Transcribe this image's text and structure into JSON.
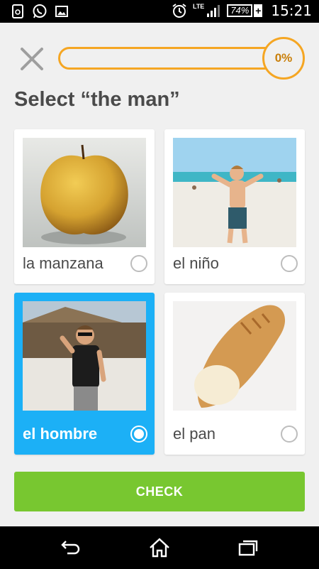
{
  "status_bar": {
    "network": "LTE",
    "battery": "74%",
    "time": "15:21"
  },
  "progress": {
    "value": 0,
    "label": "0%"
  },
  "prompt": "Select “the man”",
  "options": [
    {
      "label": "la manzana",
      "image": "apple-image",
      "selected": false
    },
    {
      "label": "el niño",
      "image": "boy-on-beach-image",
      "selected": false
    },
    {
      "label": "el hombre",
      "image": "man-image",
      "selected": true
    },
    {
      "label": "el pan",
      "image": "bread-image",
      "selected": false
    }
  ],
  "check_button": "CHECK",
  "colors": {
    "accent_orange": "#f5a623",
    "selected_blue": "#1cb0f6",
    "check_green": "#78c730"
  }
}
